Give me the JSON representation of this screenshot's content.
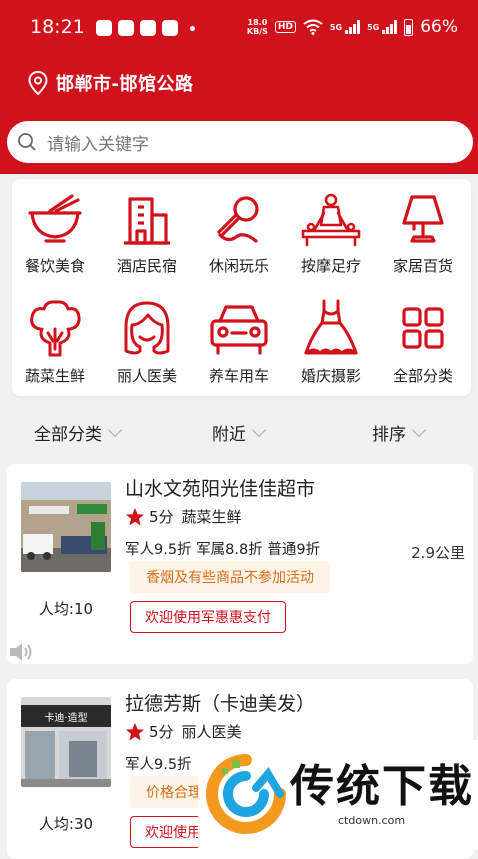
{
  "status_bar": {
    "time": "18:21",
    "net_speed_top": "18.0",
    "net_speed_bottom": "KB/S",
    "hd": "HD",
    "sig1": "5G",
    "sig2": "5G",
    "battery": "66%"
  },
  "location": {
    "text": "邯郸市-邯馆公路"
  },
  "search": {
    "placeholder": "请输入关键字"
  },
  "categories": [
    {
      "label": "餐饮美食",
      "icon": "bowl-icon"
    },
    {
      "label": "酒店民宿",
      "icon": "hotel-icon"
    },
    {
      "label": "休闲玩乐",
      "icon": "microphone-icon"
    },
    {
      "label": "按摩足疗",
      "icon": "massage-icon"
    },
    {
      "label": "家居百货",
      "icon": "lamp-icon"
    },
    {
      "label": "蔬菜生鲜",
      "icon": "broccoli-icon"
    },
    {
      "label": "丽人医美",
      "icon": "woman-face-icon"
    },
    {
      "label": "养车用车",
      "icon": "car-icon"
    },
    {
      "label": "婚庆摄影",
      "icon": "wedding-dress-icon"
    },
    {
      "label": "全部分类",
      "icon": "grid-icon"
    }
  ],
  "filters": [
    {
      "label": "全部分类"
    },
    {
      "label": "附近"
    },
    {
      "label": "排序"
    }
  ],
  "stores": [
    {
      "name": "山水文苑阳光佳佳超市",
      "score": "5分",
      "category": "蔬菜生鲜",
      "discount": "军人9.5折 军属8.8折 普通9折",
      "distance": "2.9公里",
      "note": "香烟及有些商品不参加活动",
      "pay_label": "欢迎使用军惠惠支付",
      "avg": "人均:10"
    },
    {
      "name": "拉德芳斯（卡迪美发）",
      "score": "5分",
      "category": "丽人医美",
      "discount": "军人9.5折",
      "note": "价格合理",
      "pay_label": "欢迎使用",
      "avg": "人均:30"
    }
  ],
  "watermark": {
    "title": "传统下载",
    "url": "ctdown.com"
  },
  "colors": {
    "brand_red": "#d1111c",
    "note_bg": "#fdf3e6",
    "note_text": "#d86d1f"
  }
}
